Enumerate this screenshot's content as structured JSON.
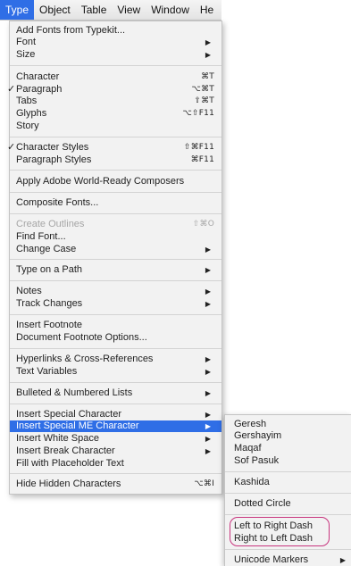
{
  "menubar": {
    "items": [
      "Type",
      "Object",
      "Table",
      "View",
      "Window",
      "He"
    ]
  },
  "menu": {
    "items": {
      "add_fonts": {
        "label": "Add Fonts from Typekit..."
      },
      "font": {
        "label": "Font"
      },
      "size": {
        "label": "Size"
      },
      "character": {
        "label": "Character",
        "shortcut": "⌘T"
      },
      "paragraph": {
        "label": "Paragraph",
        "shortcut": "⌥⌘T",
        "checked": true
      },
      "tabs": {
        "label": "Tabs",
        "shortcut": "⇧⌘T"
      },
      "glyphs": {
        "label": "Glyphs",
        "shortcut": "⌥⇧F11"
      },
      "story": {
        "label": "Story"
      },
      "character_styles": {
        "label": "Character Styles",
        "shortcut": "⇧⌘F11",
        "checked": true
      },
      "paragraph_styles": {
        "label": "Paragraph Styles",
        "shortcut": "⌘F11"
      },
      "world_ready": {
        "label": "Apply Adobe World-Ready Composers"
      },
      "composite_fonts": {
        "label": "Composite Fonts..."
      },
      "create_outlines": {
        "label": "Create Outlines",
        "shortcut": "⇧⌘O",
        "disabled": true
      },
      "find_font": {
        "label": "Find Font..."
      },
      "change_case": {
        "label": "Change Case"
      },
      "type_on_path": {
        "label": "Type on a Path"
      },
      "notes": {
        "label": "Notes"
      },
      "track_changes": {
        "label": "Track Changes"
      },
      "insert_footnote": {
        "label": "Insert Footnote"
      },
      "doc_footnote_options": {
        "label": "Document Footnote Options..."
      },
      "hyperlinks": {
        "label": "Hyperlinks & Cross-References"
      },
      "text_variables": {
        "label": "Text Variables"
      },
      "bulleted_lists": {
        "label": "Bulleted & Numbered Lists"
      },
      "insert_special_char": {
        "label": "Insert Special Character"
      },
      "insert_special_me": {
        "label": "Insert Special ME Character",
        "highlighted": true
      },
      "insert_white_space": {
        "label": "Insert White Space"
      },
      "insert_break_char": {
        "label": "Insert Break Character"
      },
      "fill_placeholder": {
        "label": "Fill with Placeholder Text"
      },
      "hide_hidden": {
        "label": "Hide Hidden Characters",
        "shortcut": "⌥⌘I"
      }
    }
  },
  "submenu": {
    "items": {
      "geresh": {
        "label": "Geresh"
      },
      "gershayim": {
        "label": "Gershayim"
      },
      "maqaf": {
        "label": "Maqaf"
      },
      "sof_pasuk": {
        "label": "Sof Pasuk"
      },
      "kashida": {
        "label": "Kashida"
      },
      "dotted_circle": {
        "label": "Dotted Circle"
      },
      "ltr_dash": {
        "label": "Left to Right Dash"
      },
      "rtl_dash": {
        "label": "Right to Left Dash"
      },
      "unicode_markers": {
        "label": "Unicode Markers"
      }
    }
  },
  "annotation": {
    "color": "#c8357e"
  },
  "colors": {
    "highlight": "#2f6ee6",
    "menu_bg": "#f2f2f2"
  }
}
